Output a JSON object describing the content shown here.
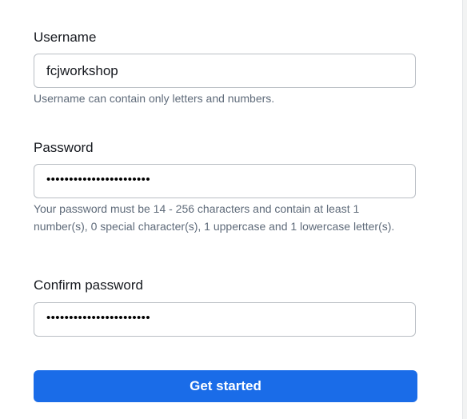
{
  "form": {
    "username": {
      "label": "Username",
      "value": "fcjworkshop",
      "hint": "Username can contain only letters and numbers."
    },
    "password": {
      "label": "Password",
      "masked_value": "•••••••••••••••••••••••",
      "hint": "Your password must be 14 - 256 characters and contain at least 1 number(s), 0 special character(s), 1 uppercase and 1 lowercase letter(s)."
    },
    "confirm_password": {
      "label": "Confirm password",
      "masked_value": "•••••••••••••••••••••••"
    },
    "submit_label": "Get started"
  },
  "colors": {
    "primary_button": "#1a6ce8",
    "input_border": "#b9bec4",
    "hint_text": "#5f6b7a"
  }
}
